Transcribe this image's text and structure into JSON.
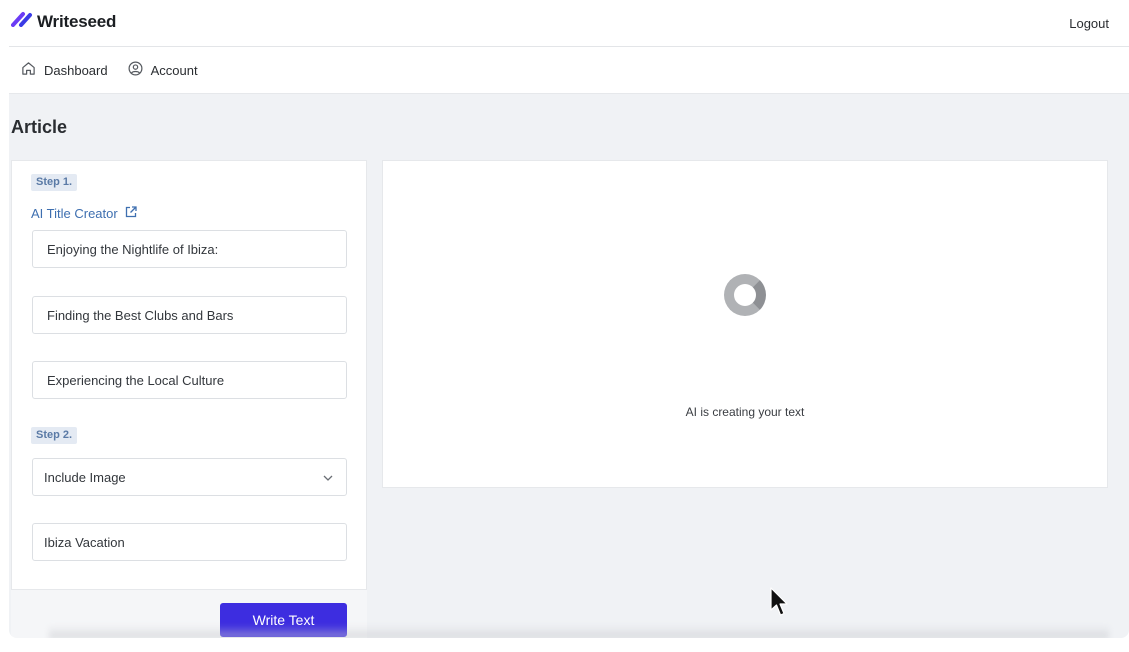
{
  "app": {
    "name": "Writeseed"
  },
  "header": {
    "logout_label": "Logout"
  },
  "nav": {
    "items": [
      {
        "label": "Dashboard",
        "icon": "home-icon"
      },
      {
        "label": "Account",
        "icon": "user-circle-icon"
      }
    ]
  },
  "page": {
    "title": "Article"
  },
  "form": {
    "step1_label": "Step 1.",
    "title_creator_label": "AI Title Creator",
    "title_fields": [
      "Enjoying the Nightlife of Ibiza:",
      "Finding the Best Clubs and Bars",
      "Experiencing the Local Culture"
    ],
    "step2_label": "Step 2.",
    "image_select_value": "Include Image",
    "keyword_value": "Ibiza Vacation",
    "write_button_label": "Write Text"
  },
  "output": {
    "status": "AI is creating your text"
  },
  "colors": {
    "accent": "#3d2de0",
    "link": "#3e6fb0",
    "badge_bg": "#e4eaf3"
  }
}
